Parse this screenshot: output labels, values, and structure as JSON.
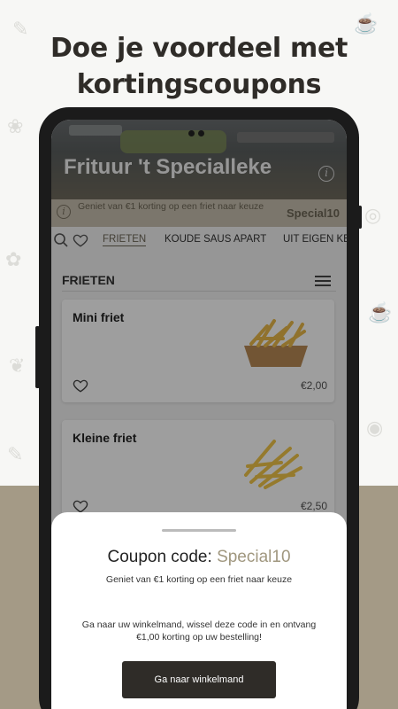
{
  "headline": {
    "line1": "Doe je voordeel met",
    "line2": "kortingscoupons"
  },
  "restaurant": {
    "name": "Frituur 't Specialleke"
  },
  "promo_banner": {
    "text": "Geniet van €1 korting op een friet naar keuze",
    "code": "Special10"
  },
  "tabs": [
    {
      "label": "FRIETEN",
      "active": true
    },
    {
      "label": "KOUDE SAUS APART",
      "active": false
    },
    {
      "label": "UIT EIGEN KE",
      "active": false
    }
  ],
  "section": {
    "title": "FRIETEN"
  },
  "products": [
    {
      "name": "Mini friet",
      "price": "€2,00"
    },
    {
      "name": "Kleine friet",
      "price": "€2,50"
    }
  ],
  "coupon_sheet": {
    "prefix": "Coupon code: ",
    "code": "Special10",
    "subtitle": "Geniet van €1 korting op een friet naar keuze",
    "description": "Ga naar uw winkelmand, wissel deze code in en ontvang €1,00 korting op uw bestelling!",
    "button_label": "Ga naar winkelmand"
  },
  "icons": {
    "search": "search-icon",
    "favorite": "heart-icon",
    "filter": "filter-icon",
    "info": "info-icon"
  },
  "colors": {
    "accent": "#a0977f",
    "dark": "#2f2c28",
    "promo_bg": "#c7bfae"
  }
}
